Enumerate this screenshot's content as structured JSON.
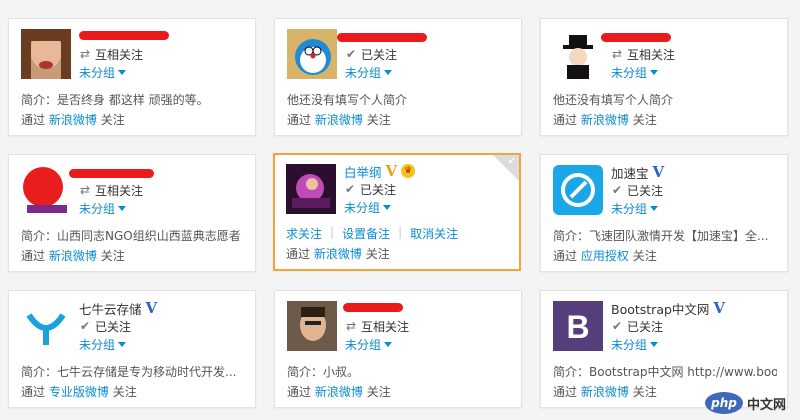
{
  "cards": [
    {
      "name": "",
      "status": "互相关注",
      "status_icon": "mutual-arrows",
      "group": "未分组",
      "intro": "简介：是否终身 都这样 顽强的等。",
      "via_prefix": "通过",
      "via_source": "新浪微博",
      "via_suffix": "关注"
    },
    {
      "name": "",
      "status": "已关注",
      "status_icon": "check",
      "group": "未分组",
      "intro": "他还没有填写个人简介",
      "via_prefix": "通过",
      "via_source": "新浪微博",
      "via_suffix": "关注"
    },
    {
      "name": "",
      "status": "互相关注",
      "status_icon": "mutual-arrows",
      "group": "未分组",
      "intro": "他还没有填写个人简介",
      "via_prefix": "通过",
      "via_source": "新浪微博",
      "via_suffix": "关注"
    },
    {
      "name": "",
      "status": "互相关注",
      "status_icon": "mutual-arrows",
      "group": "未分组",
      "intro": "简介：山西同志NGO组织山西蓝典志愿者",
      "via_prefix": "通过",
      "via_source": "新浪微博",
      "via_suffix": "关注"
    },
    {
      "name": "白举纲",
      "status": "已关注",
      "status_icon": "check",
      "group": "未分组",
      "actions": [
        "求关注",
        "设置备注",
        "取消关注"
      ],
      "via_prefix": "通过",
      "via_source": "新浪微博",
      "via_suffix": "关注"
    },
    {
      "name": "加速宝",
      "status": "已关注",
      "status_icon": "check",
      "group": "未分组",
      "intro": "简介：飞速团队激情开发【加速宝】全...",
      "via_prefix": "通过",
      "via_source": "应用授权",
      "via_suffix": "关注"
    },
    {
      "name": "七牛云存储",
      "status": "已关注",
      "status_icon": "check",
      "group": "未分组",
      "intro": "简介：七牛云存储是专为移动时代开发...",
      "via_prefix": "通过",
      "via_source": "专业版微博",
      "via_suffix": "关注"
    },
    {
      "name": "",
      "status": "互相关注",
      "status_icon": "mutual-arrows",
      "group": "未分组",
      "intro": "简介：小叔。",
      "via_prefix": "通过",
      "via_source": "新浪微博",
      "via_suffix": "关注"
    },
    {
      "name": "Bootstrap中文网",
      "status": "已关注",
      "status_icon": "check",
      "group": "未分组",
      "intro": "简介：Bootstrap中文网 http://www.boot...",
      "via_prefix": "通过",
      "via_source": "新浪微博",
      "via_suffix": "关注"
    }
  ],
  "watermark": {
    "logo": "php",
    "text": "中文网"
  },
  "colors": {
    "link": "#0a8cd2",
    "verified": "#2b64c8",
    "active_border": "#f2a43b",
    "redaction": "#ea1b1b"
  }
}
